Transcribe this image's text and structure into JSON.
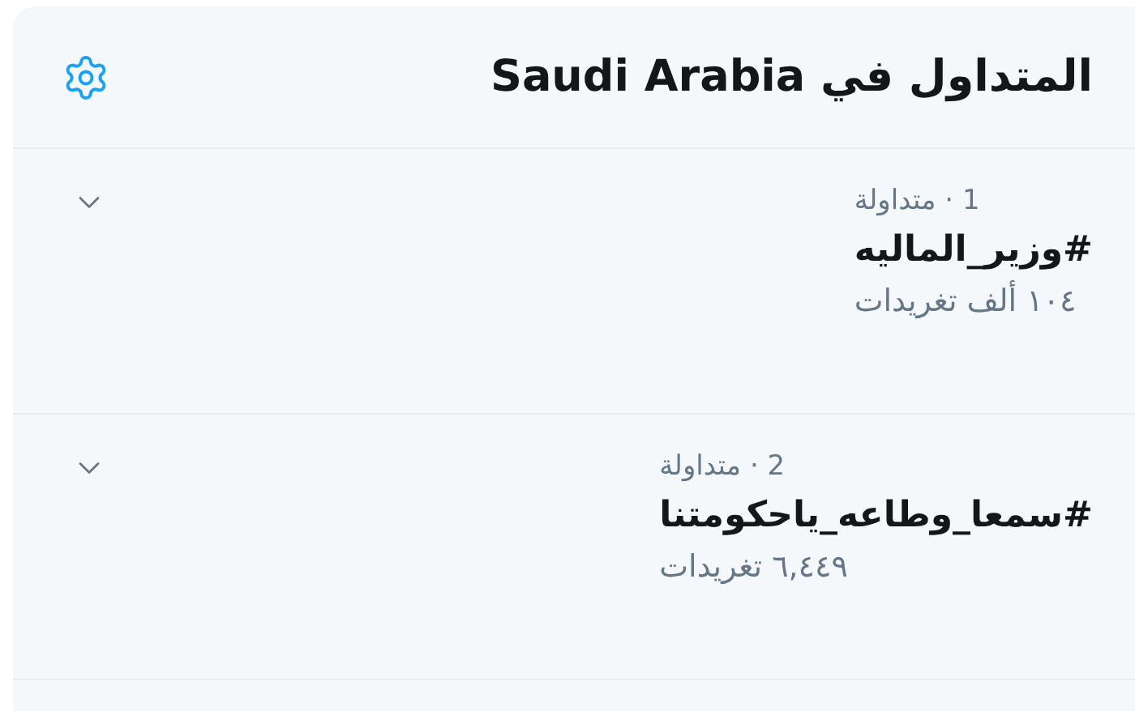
{
  "header": {
    "title": "المتداول في Saudi Arabia"
  },
  "trends": [
    {
      "meta": "1 · متداولة",
      "name": "#وزير_الماليه",
      "count": "١٠٤ ألف تغريدات"
    },
    {
      "meta": "2 · متداولة",
      "name": "#سمعا_وطاعه_ياحكومتنا",
      "count": "٦,٤٤٩ تغريدات"
    }
  ]
}
